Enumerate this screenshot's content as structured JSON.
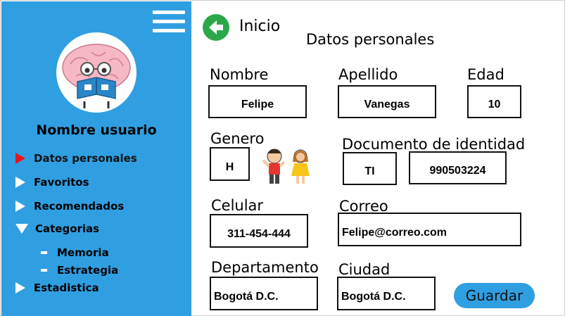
{
  "sidebar": {
    "user_name": "Nombre usuario",
    "items": [
      {
        "label": "Datos personales",
        "active": true
      },
      {
        "label": "Favoritos"
      },
      {
        "label": "Recomendados"
      },
      {
        "label": "Categorias",
        "expanded": true
      },
      {
        "label": "Estadistica"
      }
    ],
    "subitems": [
      {
        "label": "Memoria"
      },
      {
        "label": "Estrategia"
      }
    ]
  },
  "header": {
    "back_label": "Inicio",
    "section_title": "Datos personales"
  },
  "form": {
    "nombre": {
      "label": "Nombre",
      "value": "Felipe"
    },
    "apellido": {
      "label": "Apellido",
      "value": "Vanegas"
    },
    "edad": {
      "label": "Edad",
      "value": "10"
    },
    "genero": {
      "label": "Genero",
      "value": "H"
    },
    "documento": {
      "label": "Documento de identidad",
      "type": "TI",
      "number": "990503224"
    },
    "celular": {
      "label": "Celular",
      "value": "311-454-444"
    },
    "correo": {
      "label": "Correo",
      "value": "Felipe@correo.com"
    },
    "departamento": {
      "label": "Departamento",
      "value": "Bogotá D.C."
    },
    "ciudad": {
      "label": "Ciudad",
      "value": "Bogotá D.C."
    },
    "save_label": "Guardar"
  },
  "colors": {
    "sidebar_bg": "#2f9fe2",
    "active_marker": "#e8141c",
    "back_button": "#2ba84a",
    "save_button": "#2f9fe2"
  },
  "icons": {
    "menu": "hamburger-icon",
    "avatar": "brain-reading-book-icon",
    "back": "arrow-left-icon",
    "gender": "kids-icon"
  }
}
